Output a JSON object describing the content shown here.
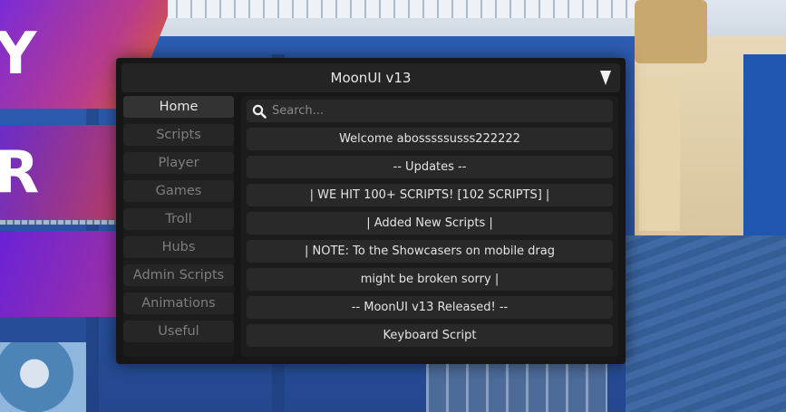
{
  "window": {
    "title": "MoonUI v13",
    "toggle_icon": "triangle-down-icon"
  },
  "sidebar": {
    "items": [
      {
        "label": "Home",
        "active": true
      },
      {
        "label": "Scripts"
      },
      {
        "label": "Player"
      },
      {
        "label": "Games"
      },
      {
        "label": "Troll"
      },
      {
        "label": "Hubs"
      },
      {
        "label": "Admin Scripts"
      },
      {
        "label": "Animations"
      },
      {
        "label": "Useful"
      }
    ]
  },
  "search": {
    "placeholder": "Search...",
    "value": "",
    "icon": "search-icon"
  },
  "content": {
    "rows": [
      "Welcome abosssssusss222222",
      "-- Updates --",
      "| WE HIT 100+ SCRIPTS! [102 SCRIPTS] |",
      "| Added New Scripts |",
      "| NOTE: To the Showcasers on mobile drag",
      "might be broken sorry |",
      "-- MoonUI v13 Released! --",
      "Keyboard Script"
    ]
  },
  "background": {
    "banners": [
      "Y",
      "R",
      ""
    ]
  },
  "colors": {
    "panel_bg": "#161616",
    "item_bg": "#292929",
    "active_item_bg": "#333333",
    "text": "#e4e4e4",
    "muted_text": "#7e7e7e"
  }
}
